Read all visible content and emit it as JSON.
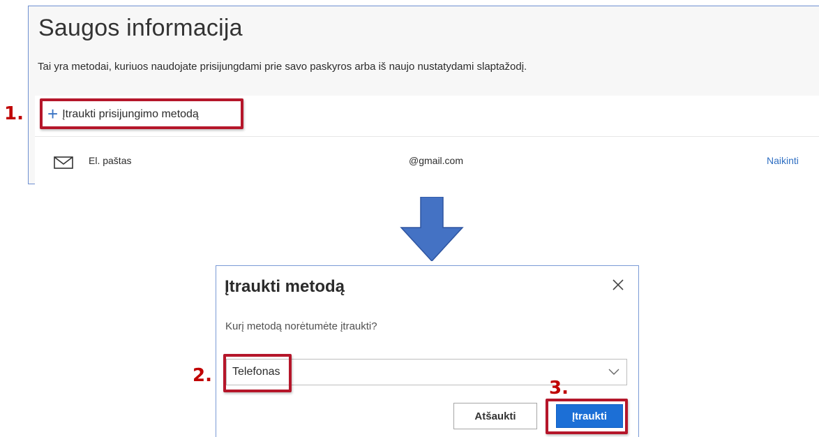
{
  "security_info": {
    "title": "Saugos informacija",
    "subtitle": "Tai yra metodai, kuriuos naudojate prisijungdami prie savo paskyros arba iš naujo nustatydami slaptažodį.",
    "add_method_label": "Įtraukti prisijungimo metodą",
    "add_icon": "plus-icon",
    "methods": [
      {
        "icon": "mail-icon",
        "name": "El. paštas",
        "value": "@gmail.com",
        "action": "Naikinti"
      }
    ]
  },
  "dialog": {
    "title": "Įtraukti metodą",
    "question": "Kurį metodą norėtumėte įtraukti?",
    "selected_option": "Telefonas",
    "cancel_label": "Atšaukti",
    "add_label": "Įtraukti"
  },
  "annotations": {
    "step1": "1.",
    "step2": "2.",
    "step3": "3."
  },
  "colors": {
    "accent": "#1c6fd6",
    "link": "#2f6fc2",
    "highlight": "#b5162a",
    "step_number": "#c00000",
    "arrow": "#4472c4"
  }
}
